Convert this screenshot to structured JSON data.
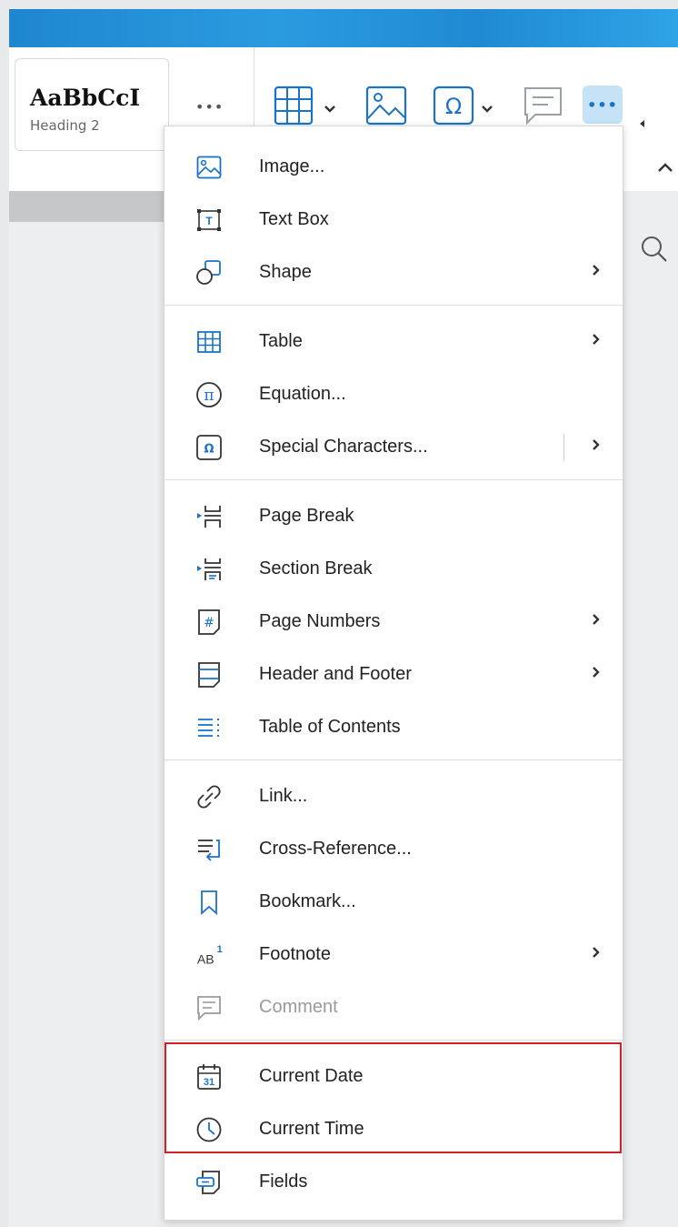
{
  "ribbon": {
    "style_sample": "AaBbCcI",
    "style_name": "Heading 2",
    "more_label": "•••",
    "more_active_label": "•••"
  },
  "menu": {
    "group1": [
      {
        "label": "Image...",
        "icon": "image-icon"
      },
      {
        "label": "Text Box",
        "icon": "text-box-icon"
      },
      {
        "label": "Shape",
        "icon": "shape-icon",
        "submenu": true
      }
    ],
    "group2": [
      {
        "label": "Table",
        "icon": "table-icon",
        "submenu": true
      },
      {
        "label": "Equation...",
        "icon": "equation-icon"
      },
      {
        "label": "Special Characters...",
        "icon": "omega-icon",
        "submenu": true
      }
    ],
    "group3": [
      {
        "label": "Page Break",
        "icon": "page-break-icon"
      },
      {
        "label": "Section Break",
        "icon": "section-break-icon"
      },
      {
        "label": "Page Numbers",
        "icon": "page-numbers-icon",
        "submenu": true
      },
      {
        "label": "Header and Footer",
        "icon": "header-footer-icon",
        "submenu": true
      },
      {
        "label": "Table of Contents",
        "icon": "toc-icon"
      }
    ],
    "group4": [
      {
        "label": "Link...",
        "icon": "link-icon"
      },
      {
        "label": "Cross-Reference...",
        "icon": "cross-reference-icon"
      },
      {
        "label": "Bookmark...",
        "icon": "bookmark-icon"
      },
      {
        "label": "Footnote",
        "icon": "footnote-icon",
        "submenu": true
      },
      {
        "label": "Comment",
        "icon": "comment-icon",
        "disabled": true
      }
    ],
    "group5": [
      {
        "label": "Current Date",
        "icon": "calendar-icon"
      },
      {
        "label": "Current Time",
        "icon": "clock-icon"
      },
      {
        "label": "Fields",
        "icon": "fields-icon"
      }
    ]
  },
  "icons": {
    "footnote_text": "AB",
    "footnote_sup": "1",
    "calendar_day": "31",
    "toolbar_more": "•••"
  },
  "colors": {
    "accent": "#1a73c8",
    "highlight_border": "#d32027",
    "topbar": "#1e86cf",
    "more_button_bg": "#c5e2f6"
  }
}
